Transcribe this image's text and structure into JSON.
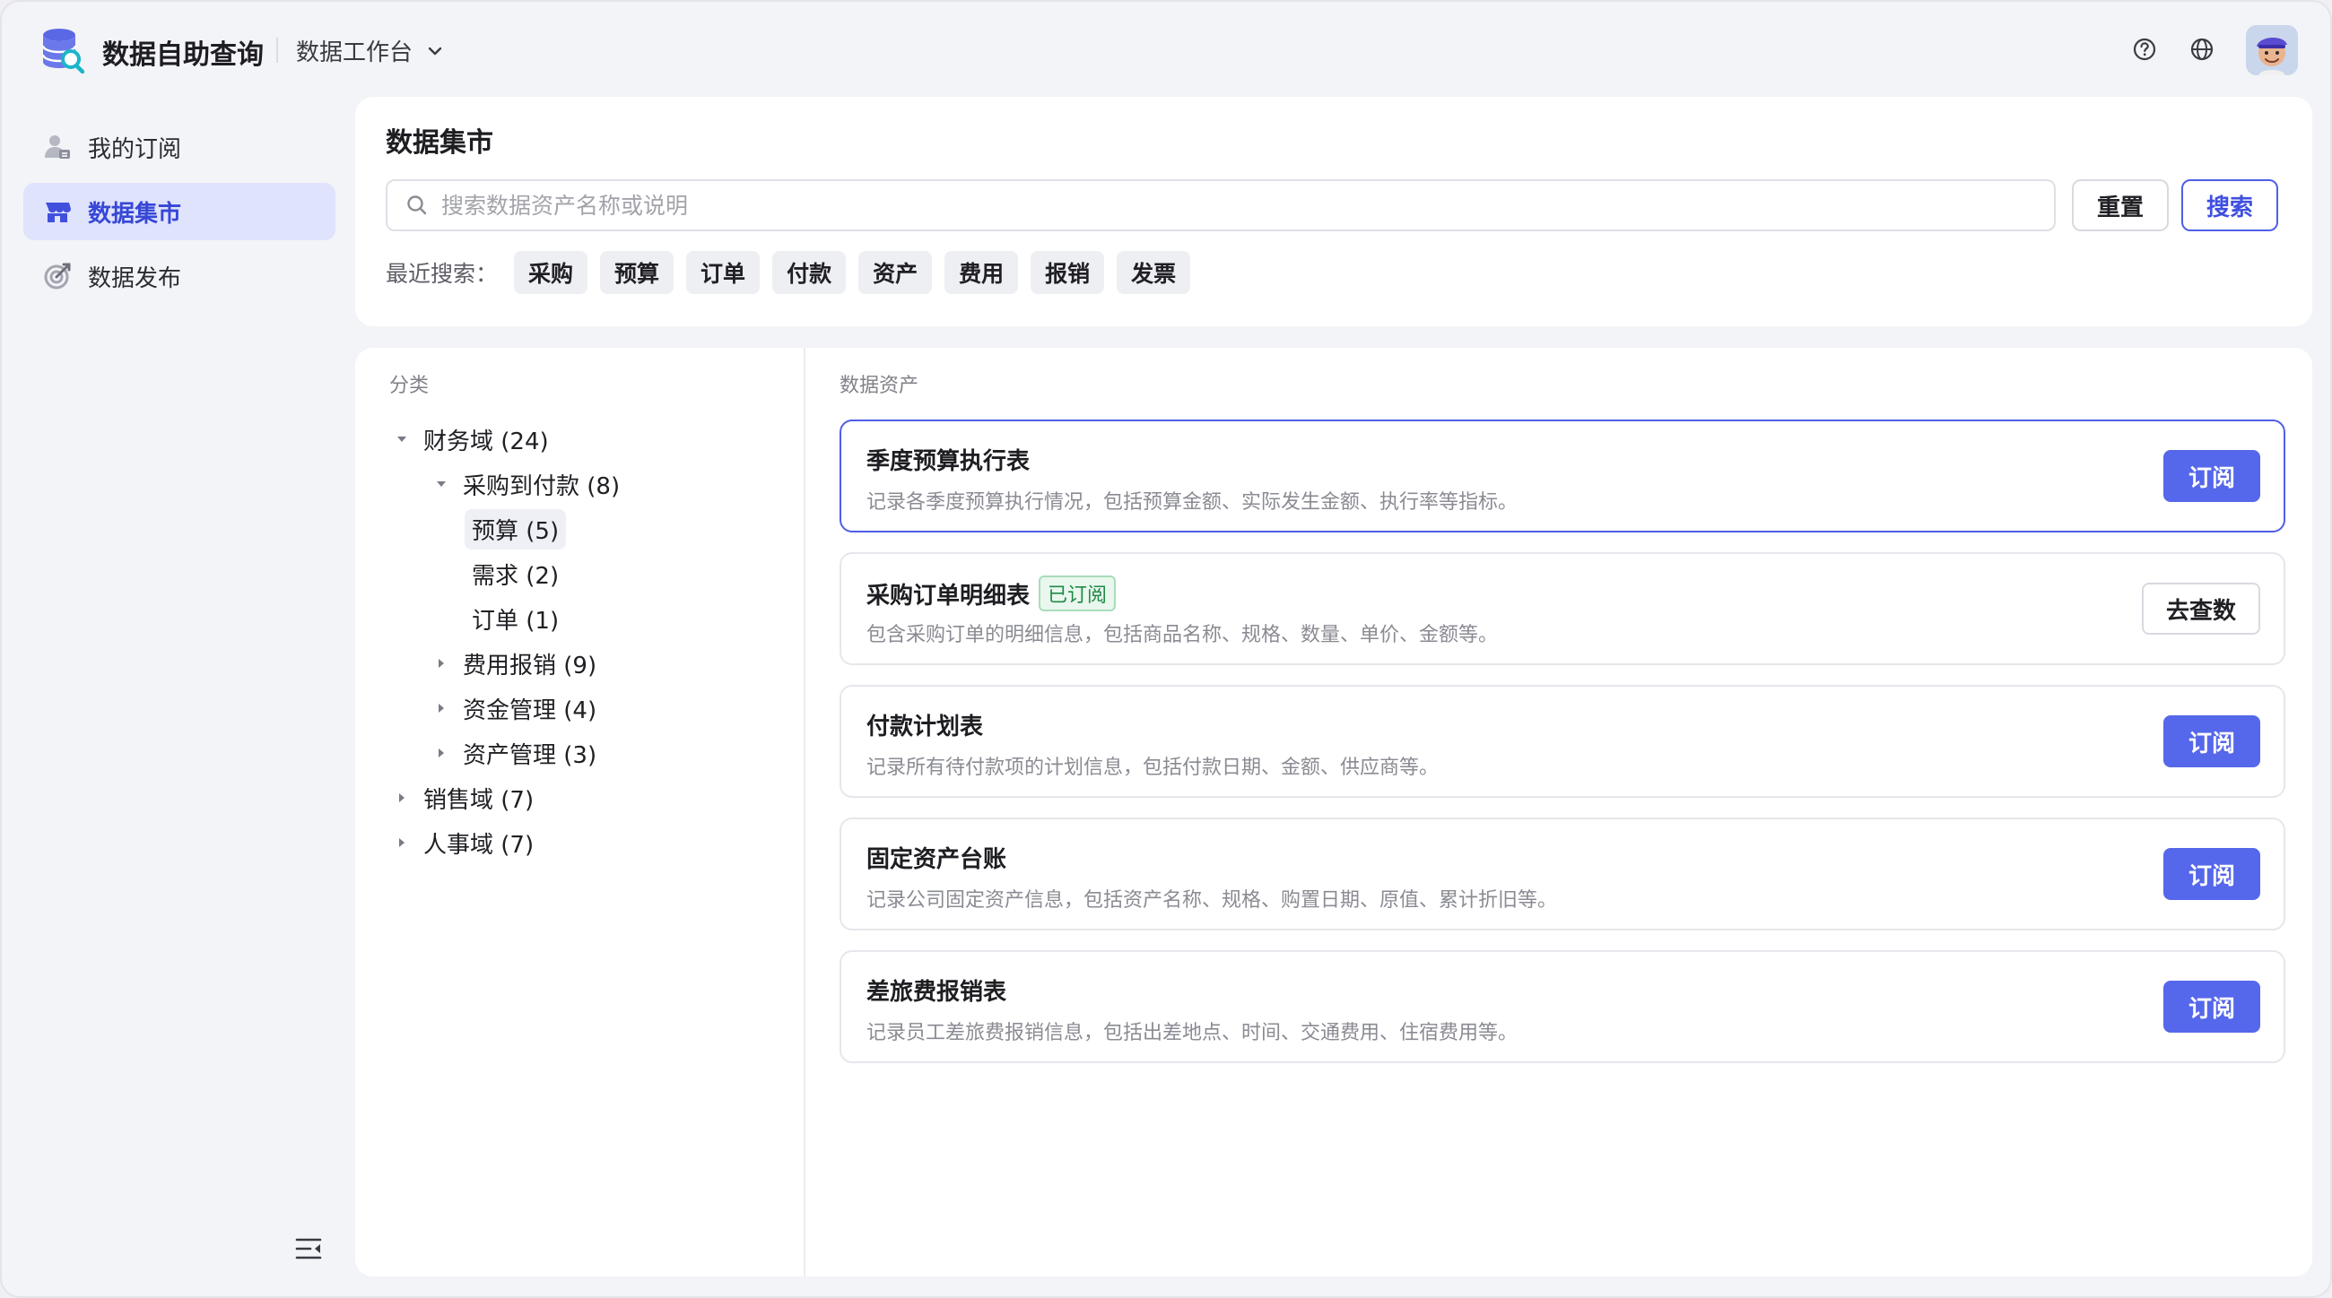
{
  "app": {
    "title": "数据自助查询",
    "workspace": "数据工作台"
  },
  "sidebar": {
    "items": [
      {
        "label": "我的订阅",
        "icon": "user-subscribe-icon",
        "active": false
      },
      {
        "label": "数据集市",
        "icon": "store-icon",
        "active": true
      },
      {
        "label": "数据发布",
        "icon": "publish-target-icon",
        "active": false
      }
    ]
  },
  "market": {
    "title": "数据集市",
    "search_placeholder": "搜索数据资产名称或说明",
    "search_value": "",
    "reset_label": "重置",
    "search_label": "搜索",
    "recent_label": "最近搜索：",
    "recent": [
      "采购",
      "预算",
      "订单",
      "付款",
      "资产",
      "费用",
      "报销",
      "发票"
    ]
  },
  "categories": {
    "label": "分类",
    "tree": [
      {
        "label": "财务域 (24)",
        "level": 0,
        "expanded": true
      },
      {
        "label": "采购到付款 (8)",
        "level": 1,
        "expanded": true
      },
      {
        "label": "预算 (5)",
        "level": 2,
        "leaf": true,
        "selected": true
      },
      {
        "label": "需求 (2)",
        "level": 2,
        "leaf": true
      },
      {
        "label": "订单 (1)",
        "level": 2,
        "leaf": true
      },
      {
        "label": "费用报销 (9)",
        "level": 1,
        "expanded": false
      },
      {
        "label": "资金管理 (4)",
        "level": 1,
        "expanded": false
      },
      {
        "label": "资产管理 (3)",
        "level": 1,
        "expanded": false
      },
      {
        "label": "销售域 (7)",
        "level": 0,
        "expanded": false
      },
      {
        "label": "人事域 (7)",
        "level": 0,
        "expanded": false
      }
    ]
  },
  "assets": {
    "label": "数据资产",
    "items": [
      {
        "title": "季度预算执行表",
        "desc": "记录各季度预算执行情况，包括预算金额、实际发生金额、执行率等指标。",
        "action": "订阅",
        "subscribed": false,
        "active": true
      },
      {
        "title": "采购订单明细表",
        "badge": "已订阅",
        "desc": "包含采购订单的明细信息，包括商品名称、规格、数量、单价、金额等。",
        "action": "去查数",
        "subscribed": true
      },
      {
        "title": "付款计划表",
        "desc": "记录所有待付款项的计划信息，包括付款日期、金额、供应商等。",
        "action": "订阅",
        "subscribed": false
      },
      {
        "title": "固定资产台账",
        "desc": "记录公司固定资产信息，包括资产名称、规格、购置日期、原值、累计折旧等。",
        "action": "订阅",
        "subscribed": false
      },
      {
        "title": "差旅费报销表",
        "desc": "记录员工差旅费报销信息，包括出差地点、时间、交通费用、住宿费用等。",
        "action": "订阅",
        "subscribed": false
      }
    ]
  },
  "colors": {
    "accent": "#5567ea",
    "accent_border": "#4f5ee6",
    "active_bg": "#dfe3fb",
    "success": "#1f8a46"
  }
}
